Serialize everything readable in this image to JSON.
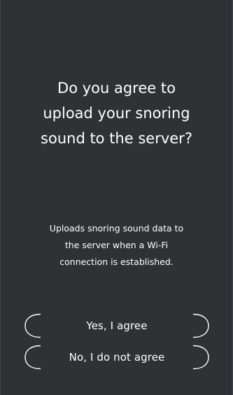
{
  "consent": {
    "question": "Do you agree to\nupload your snoring\nsound to the server?",
    "description": "Uploads snoring sound data to\nthe server when a Wi-Fi\nconnection is established.",
    "agree_label": "Yes, I agree",
    "disagree_label": "No, I do not agree"
  },
  "icons": {
    "left_bracket": "left-bracket-icon",
    "right_bracket": "right-bracket-icon"
  },
  "colors": {
    "background": "#2f3135",
    "text": "#ffffff"
  }
}
